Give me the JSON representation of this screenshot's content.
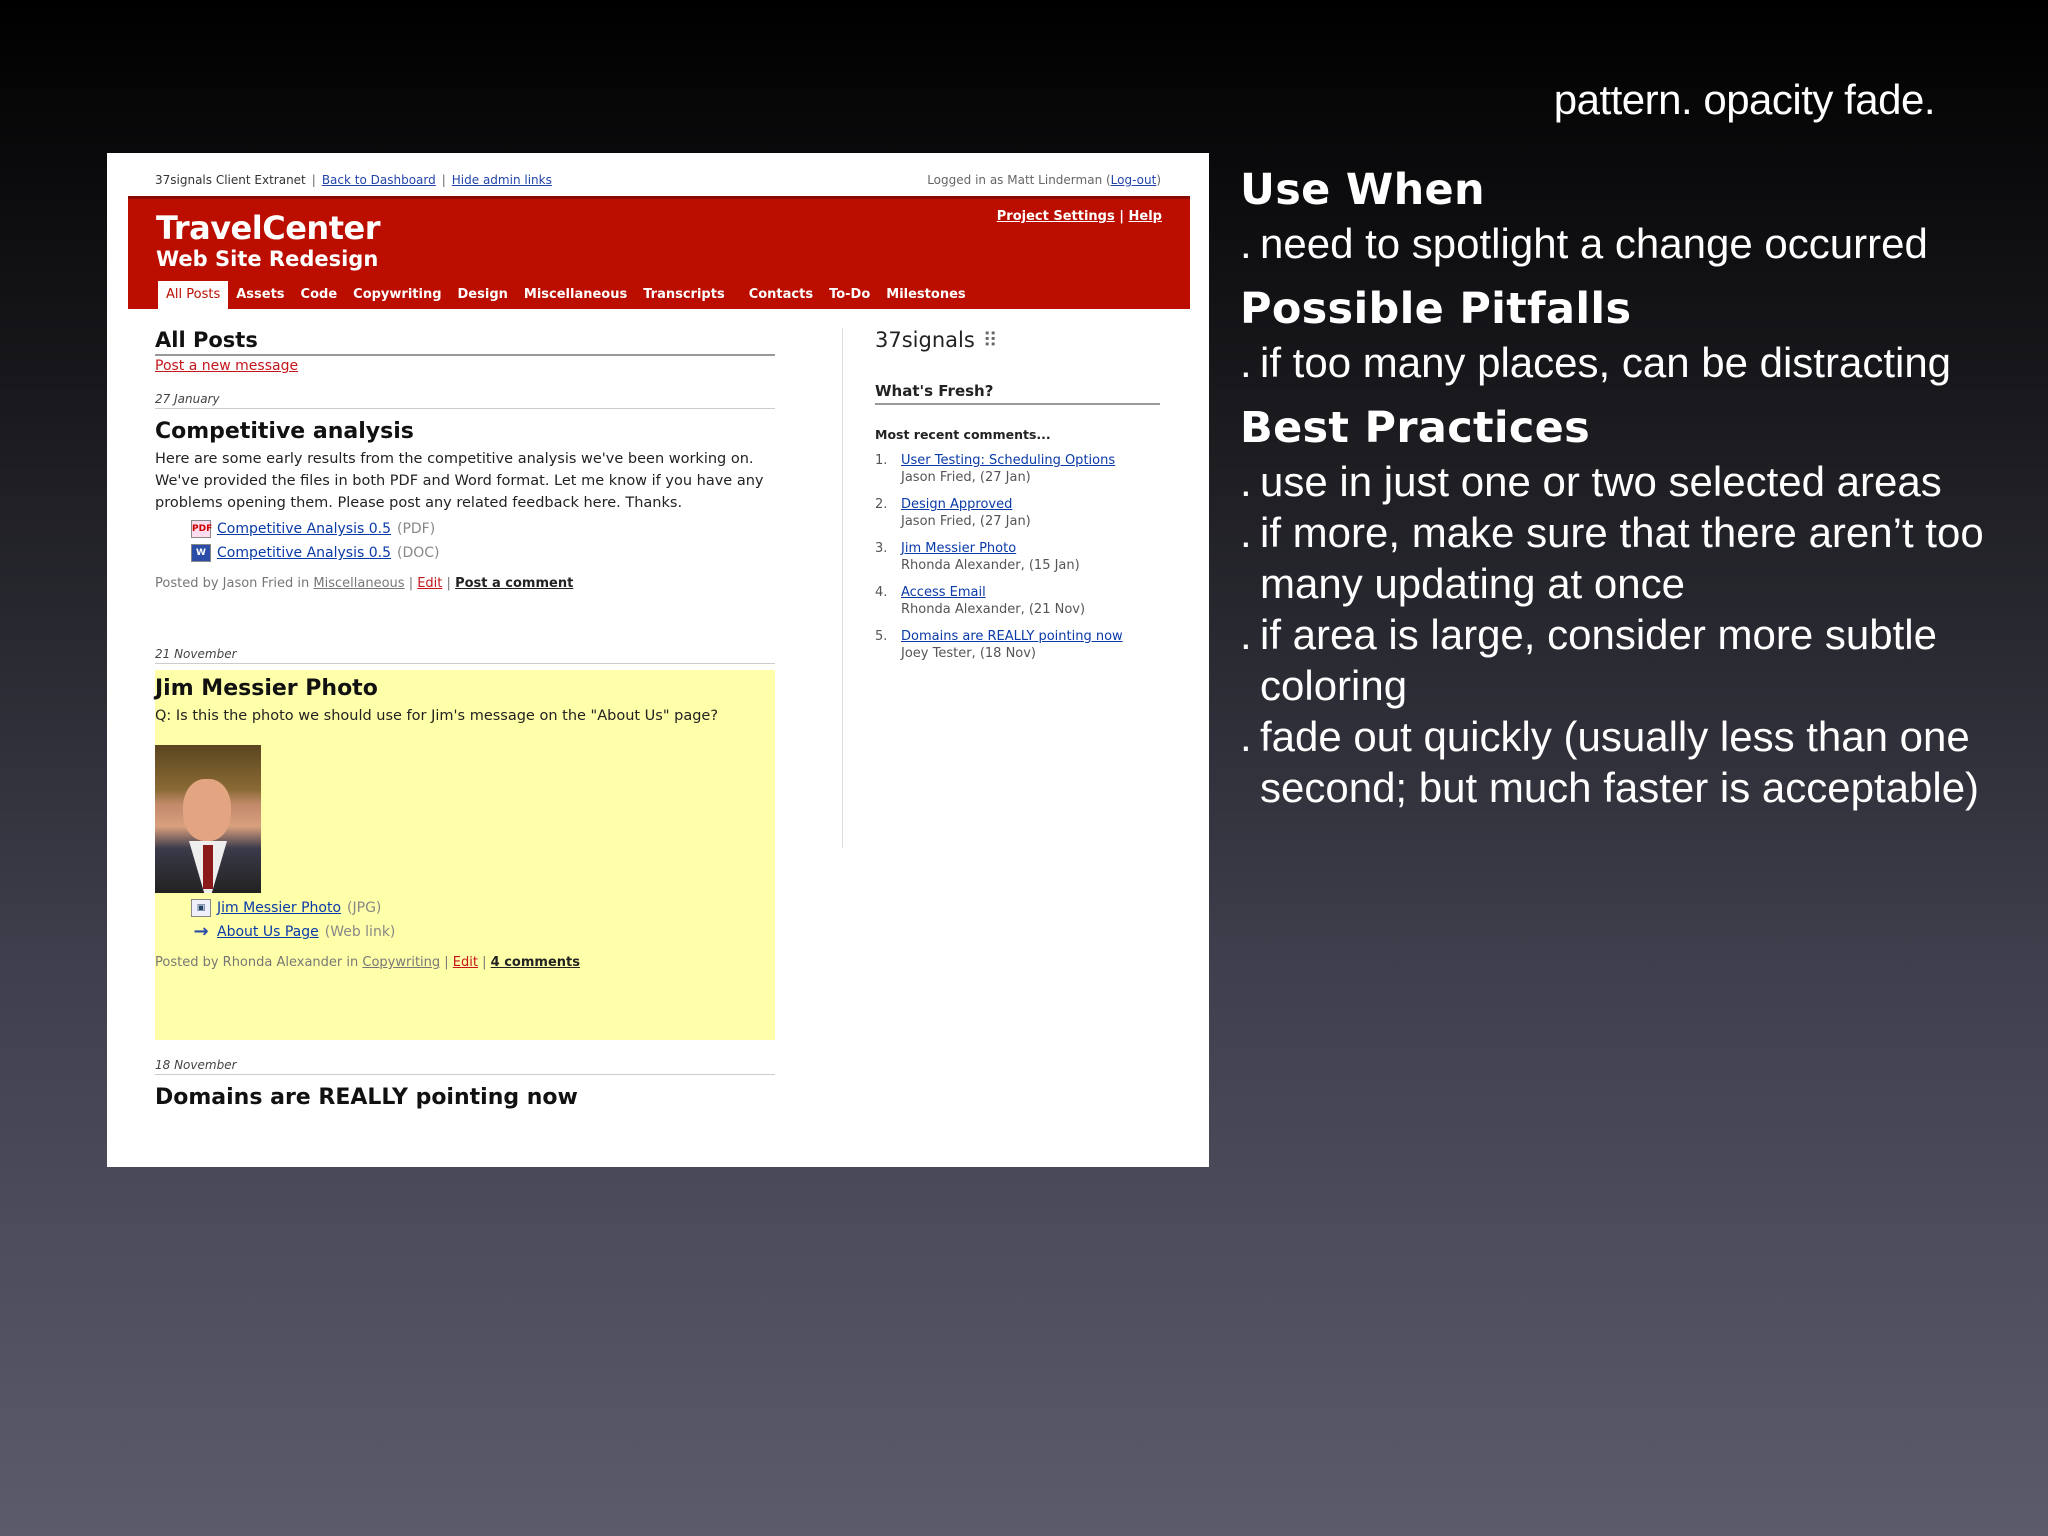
{
  "slide": {
    "title": "pattern. opacity fade.",
    "sections": [
      {
        "heading": "Use When",
        "bullets": [
          "need to spotlight a change occurred"
        ]
      },
      {
        "heading": "Possible Pitfalls",
        "bullets": [
          "if too many places, can be distracting"
        ]
      },
      {
        "heading": "Best Practices",
        "bullets": [
          "use in just one or two selected areas",
          "if more, make sure that there aren’t too many updating at once",
          "if area is large, consider more subtle coloring",
          "fade out quickly (usually less than one second; but much faster is acceptable)"
        ]
      }
    ]
  },
  "screenshot": {
    "topbar": {
      "site": "37signals Client Extranet",
      "back_link": "Back to Dashboard",
      "hide_link": "Hide admin links",
      "logged_in": "Logged in as Matt Linderman",
      "logout": "Log-out"
    },
    "header": {
      "title": "TravelCenter",
      "subtitle": "Web Site Redesign",
      "settings": "Project Settings",
      "help": "Help",
      "tabs": [
        "All Posts",
        "Assets",
        "Code",
        "Copywriting",
        "Design",
        "Miscellaneous",
        "Transcripts",
        "Contacts",
        "To-Do",
        "Milestones"
      ],
      "accent": "#bb0e00"
    },
    "main": {
      "heading": "All Posts",
      "post_new": "Post a new message",
      "posts": [
        {
          "date": "27 January",
          "title": "Competitive analysis",
          "body": "Here are some early results from the competitive analysis we've been working on. We've provided the files in both PDF and Word format. Let me know if you have any problems opening them. Please post any related feedback here. Thanks.",
          "attachments": [
            {
              "icon": "pdf-file-icon",
              "name": "Competitive Analysis 0.5",
              "type": "(PDF)"
            },
            {
              "icon": "word-file-icon",
              "name": "Competitive Analysis 0.5",
              "type": "(DOC)"
            }
          ],
          "meta_prefix": "Posted by Jason Fried in",
          "category": "Miscellaneous",
          "edit": "Edit",
          "comment": "Post a comment"
        },
        {
          "date": "21 November",
          "title": "Jim Messier Photo",
          "body": "Q: Is this the photo we should use for Jim's message on the \"About Us\" page?",
          "attachments": [
            {
              "icon": "image-file-icon",
              "name": "Jim Messier Photo",
              "type": "(JPG)"
            },
            {
              "icon": "weblink-arrow-icon",
              "name": "About Us Page",
              "type": "(Web link)"
            }
          ],
          "meta_prefix": "Posted by Rhonda Alexander in",
          "category": "Copywriting",
          "edit": "Edit",
          "comment": "4 comments",
          "highlight": "#ffffaa"
        },
        {
          "date": "18 November",
          "title": "Domains are REALLY pointing now"
        }
      ]
    },
    "sidebar": {
      "logo": "37signals",
      "fresh": "What's Fresh?",
      "recent_heading": "Most recent comments...",
      "items": [
        {
          "n": "1.",
          "title": "User Testing: Scheduling Options",
          "by": "Jason Fried, (27 Jan)"
        },
        {
          "n": "2.",
          "title": "Design Approved",
          "by": "Jason Fried, (27 Jan)"
        },
        {
          "n": "3.",
          "title": "Jim Messier Photo",
          "by": "Rhonda Alexander, (15 Jan)"
        },
        {
          "n": "4.",
          "title": "Access Email",
          "by": "Rhonda Alexander, (21 Nov)"
        },
        {
          "n": "5.",
          "title": "Domains are REALLY pointing now",
          "by": "Joey Tester, (18 Nov)"
        }
      ]
    }
  }
}
